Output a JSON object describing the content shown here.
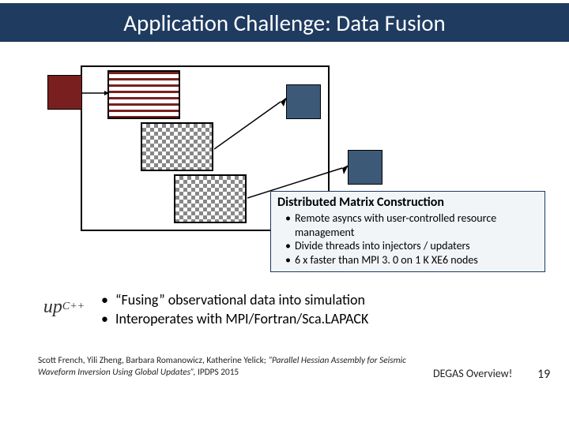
{
  "title": "Application Challenge: Data Fusion",
  "callout": {
    "title": "Distributed Matrix Construction",
    "items": [
      "Remote asyncs with user-controlled resource management",
      "Divide threads into injectors / updaters",
      "6 x faster than MPI 3. 0 on 1 K XE6 nodes"
    ]
  },
  "body_bullets": [
    "“Fusing” observational data into simulation",
    "Interoperates with MPI/Fortran/Sca.LAPACK"
  ],
  "logo": {
    "base": "up",
    "sup": "C++"
  },
  "citation": {
    "authors": "Scott French, Yili Zheng, Barbara Romanowicz, Katherine Yelick; ",
    "title_italic": "“Parallel Hessian Assembly for Seismic Waveform Inversion Using Global Updates”, ",
    "venue": "IPDPS 2015"
  },
  "footer": {
    "label": "DEGAS Overview!",
    "page": "19"
  }
}
